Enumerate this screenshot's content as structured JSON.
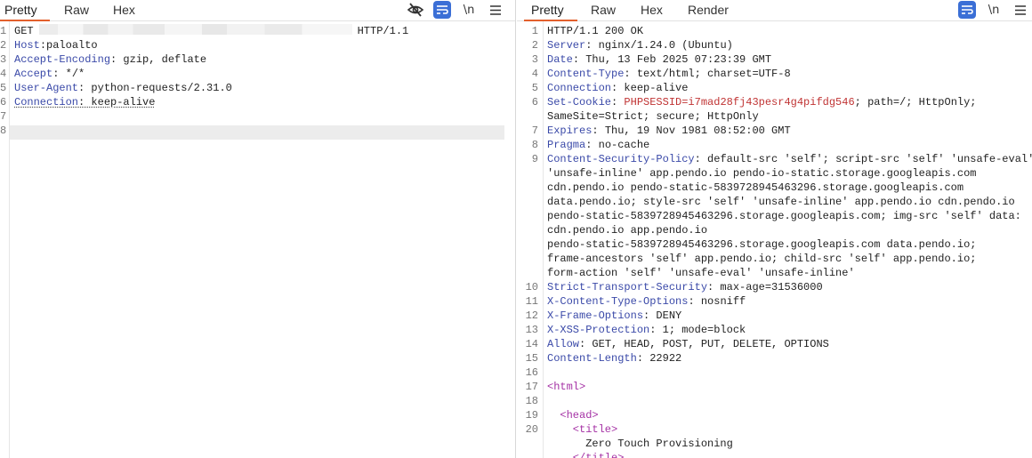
{
  "request": {
    "tabs": [
      "Pretty",
      "Raw",
      "Hex"
    ],
    "lines": [
      {
        "n": "1",
        "parts": [
          {
            "t": "GET",
            "c": "plain"
          },
          {
            "t": "",
            "c": "blur"
          },
          {
            "t": "HTTP/1.1",
            "c": "plain"
          }
        ]
      },
      {
        "n": "2",
        "parts": [
          {
            "t": "Host",
            "c": "hn"
          },
          {
            "t": ":paloalto",
            "c": "hv"
          }
        ]
      },
      {
        "n": "3",
        "parts": [
          {
            "t": "Accept-Encoding",
            "c": "hn"
          },
          {
            "t": ": gzip, deflate",
            "c": "hv"
          }
        ]
      },
      {
        "n": "4",
        "parts": [
          {
            "t": "Accept",
            "c": "hn"
          },
          {
            "t": ": */*",
            "c": "hv"
          }
        ]
      },
      {
        "n": "5",
        "parts": [
          {
            "t": "User-Agent",
            "c": "hn"
          },
          {
            "t": ": python-requests/2.31.0",
            "c": "hv"
          }
        ]
      },
      {
        "n": "6",
        "parts": [
          {
            "t": "Connection",
            "c": "hn squig"
          },
          {
            "t": ": keep-alive",
            "c": "hv squig"
          }
        ]
      },
      {
        "n": "7",
        "parts": []
      },
      {
        "n": "8",
        "parts": []
      }
    ]
  },
  "response": {
    "tabs": [
      "Pretty",
      "Raw",
      "Hex",
      "Render"
    ],
    "lines": [
      {
        "n": "1",
        "parts": [
          {
            "t": "HTTP/1.1 200 OK",
            "c": "plain"
          }
        ]
      },
      {
        "n": "2",
        "parts": [
          {
            "t": "Server",
            "c": "hn"
          },
          {
            "t": ": nginx/1.24.0 (Ubuntu)",
            "c": "hv"
          }
        ]
      },
      {
        "n": "3",
        "parts": [
          {
            "t": "Date",
            "c": "hn"
          },
          {
            "t": ": Thu, 13 Feb 2025 07:23:39 GMT",
            "c": "hv"
          }
        ]
      },
      {
        "n": "4",
        "parts": [
          {
            "t": "Content-Type",
            "c": "hn"
          },
          {
            "t": ": text/html; charset=UTF-8",
            "c": "hv"
          }
        ]
      },
      {
        "n": "5",
        "parts": [
          {
            "t": "Connection",
            "c": "hn"
          },
          {
            "t": ": keep-alive",
            "c": "hv"
          }
        ]
      },
      {
        "n": "6",
        "parts": [
          {
            "t": "Set-Cookie",
            "c": "hn"
          },
          {
            "t": ": ",
            "c": "hv"
          },
          {
            "t": "PHPSESSID=i7mad28fj43pesr4g4pifdg546",
            "c": "ck"
          },
          {
            "t": "; path=/; HttpOnly;",
            "c": "hv"
          }
        ]
      },
      {
        "n": "",
        "parts": [
          {
            "t": "SameSite=Strict; secure; HttpOnly",
            "c": "hv"
          }
        ]
      },
      {
        "n": "7",
        "parts": [
          {
            "t": "Expires",
            "c": "hn"
          },
          {
            "t": ": Thu, 19 Nov 1981 08:52:00 GMT",
            "c": "hv"
          }
        ]
      },
      {
        "n": "8",
        "parts": [
          {
            "t": "Pragma",
            "c": "hn"
          },
          {
            "t": ": no-cache",
            "c": "hv"
          }
        ]
      },
      {
        "n": "9",
        "parts": [
          {
            "t": "Content-Security-Policy",
            "c": "hn"
          },
          {
            "t": ": default-src 'self'; script-src 'self' 'unsafe-eval'",
            "c": "hv"
          }
        ]
      },
      {
        "n": "",
        "parts": [
          {
            "t": "'unsafe-inline' app.pendo.io pendo-io-static.storage.googleapis.com",
            "c": "hv"
          }
        ]
      },
      {
        "n": "",
        "parts": [
          {
            "t": "cdn.pendo.io pendo-static-5839728945463296.storage.googleapis.com",
            "c": "hv"
          }
        ]
      },
      {
        "n": "",
        "parts": [
          {
            "t": "data.pendo.io; style-src 'self' 'unsafe-inline' app.pendo.io cdn.pendo.io",
            "c": "hv"
          }
        ]
      },
      {
        "n": "",
        "parts": [
          {
            "t": "pendo-static-5839728945463296.storage.googleapis.com; img-src 'self' data:",
            "c": "hv"
          }
        ]
      },
      {
        "n": "",
        "parts": [
          {
            "t": "cdn.pendo.io app.pendo.io",
            "c": "hv"
          }
        ]
      },
      {
        "n": "",
        "parts": [
          {
            "t": "pendo-static-5839728945463296.storage.googleapis.com data.pendo.io;",
            "c": "hv"
          }
        ]
      },
      {
        "n": "",
        "parts": [
          {
            "t": "frame-ancestors 'self' app.pendo.io; child-src 'self' app.pendo.io;",
            "c": "hv"
          }
        ]
      },
      {
        "n": "",
        "parts": [
          {
            "t": "form-action 'self' 'unsafe-eval' 'unsafe-inline'",
            "c": "hv"
          }
        ]
      },
      {
        "n": "10",
        "parts": [
          {
            "t": "Strict-Transport-Security",
            "c": "hn"
          },
          {
            "t": ": max-age=31536000",
            "c": "hv"
          }
        ]
      },
      {
        "n": "11",
        "parts": [
          {
            "t": "X-Content-Type-Options",
            "c": "hn"
          },
          {
            "t": ": nosniff",
            "c": "hv"
          }
        ]
      },
      {
        "n": "12",
        "parts": [
          {
            "t": "X-Frame-Options",
            "c": "hn"
          },
          {
            "t": ": DENY",
            "c": "hv"
          }
        ]
      },
      {
        "n": "13",
        "parts": [
          {
            "t": "X-XSS-Protection",
            "c": "hn"
          },
          {
            "t": ": 1; mode=block",
            "c": "hv"
          }
        ]
      },
      {
        "n": "14",
        "parts": [
          {
            "t": "Allow",
            "c": "hn"
          },
          {
            "t": ": GET, HEAD, POST, PUT, DELETE, OPTIONS",
            "c": "hv"
          }
        ]
      },
      {
        "n": "15",
        "parts": [
          {
            "t": "Content-Length",
            "c": "hn"
          },
          {
            "t": ": 22922",
            "c": "hv"
          }
        ]
      },
      {
        "n": "16",
        "parts": []
      },
      {
        "n": "17",
        "parts": [
          {
            "t": "<html>",
            "c": "tag"
          }
        ]
      },
      {
        "n": "18",
        "parts": []
      },
      {
        "n": "19",
        "parts": [
          {
            "t": "  <head>",
            "c": "tag"
          }
        ]
      },
      {
        "n": "20",
        "parts": [
          {
            "t": "    <title>",
            "c": "tag"
          }
        ]
      },
      {
        "n": "",
        "parts": [
          {
            "t": "      Zero Touch Provisioning",
            "c": "plain"
          }
        ]
      },
      {
        "n": "",
        "parts": [
          {
            "t": "    </title>",
            "c": "tag"
          }
        ]
      }
    ]
  },
  "toolbar": {
    "hide_icon": "eye-off-icon",
    "wrap_icon": "word-wrap-icon",
    "newline_label": "\\n",
    "menu_icon": "hamburger-menu-icon"
  },
  "colors": {
    "accent_tab": "#e3602c",
    "toggle_on": "#3b6fd6",
    "header_name": "#3a49a8",
    "cookie_value": "#c03434",
    "html_tag": "#a532a5"
  }
}
